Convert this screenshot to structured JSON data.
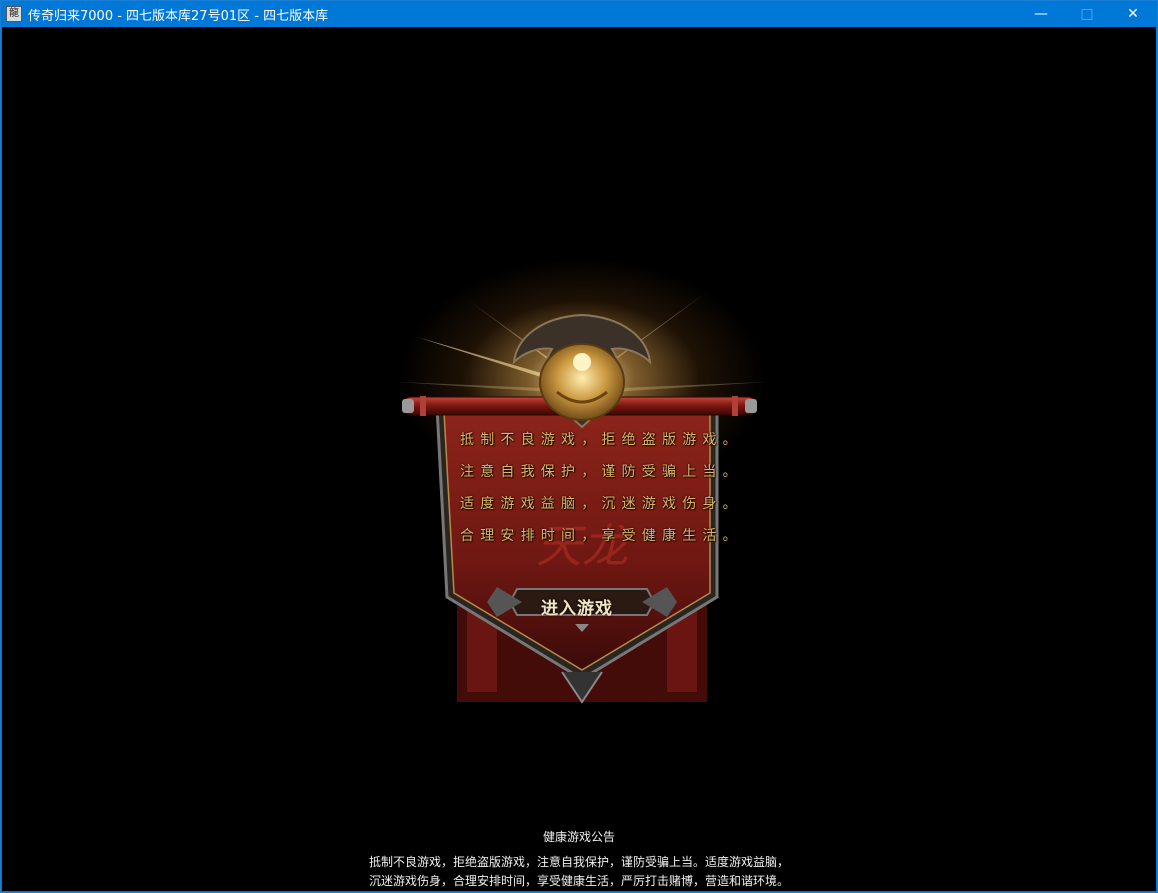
{
  "window": {
    "title": "传奇归来7000 - 四七版本库27号01区 - 四七版本库",
    "icon_text": "龍",
    "controls": {
      "minimize": "—",
      "maximize": "□",
      "close": "✕"
    }
  },
  "banner": {
    "lines": [
      "抵制不良游戏，拒绝盗版游戏。",
      "注意自我保护，谨防受骗上当。",
      "适度游戏益脑，沉迷游戏伤身。",
      "合理安排时间，享受健康生活。"
    ],
    "enter_button": "进入游戏"
  },
  "notice": {
    "title": "健康游戏公告",
    "line1": "抵制不良游戏，拒绝盗版游戏，注意自我保护，谨防受骗上当。适度游戏益脑，",
    "line2": "沉迷游戏伤身，合理安排时间，享受健康生活，严厉打击赌博，营造和谐环境。"
  },
  "colors": {
    "titlebar": "#0078d7",
    "background": "#000000",
    "banner_red": "#7a1a14",
    "gold": "#d8b66a"
  }
}
